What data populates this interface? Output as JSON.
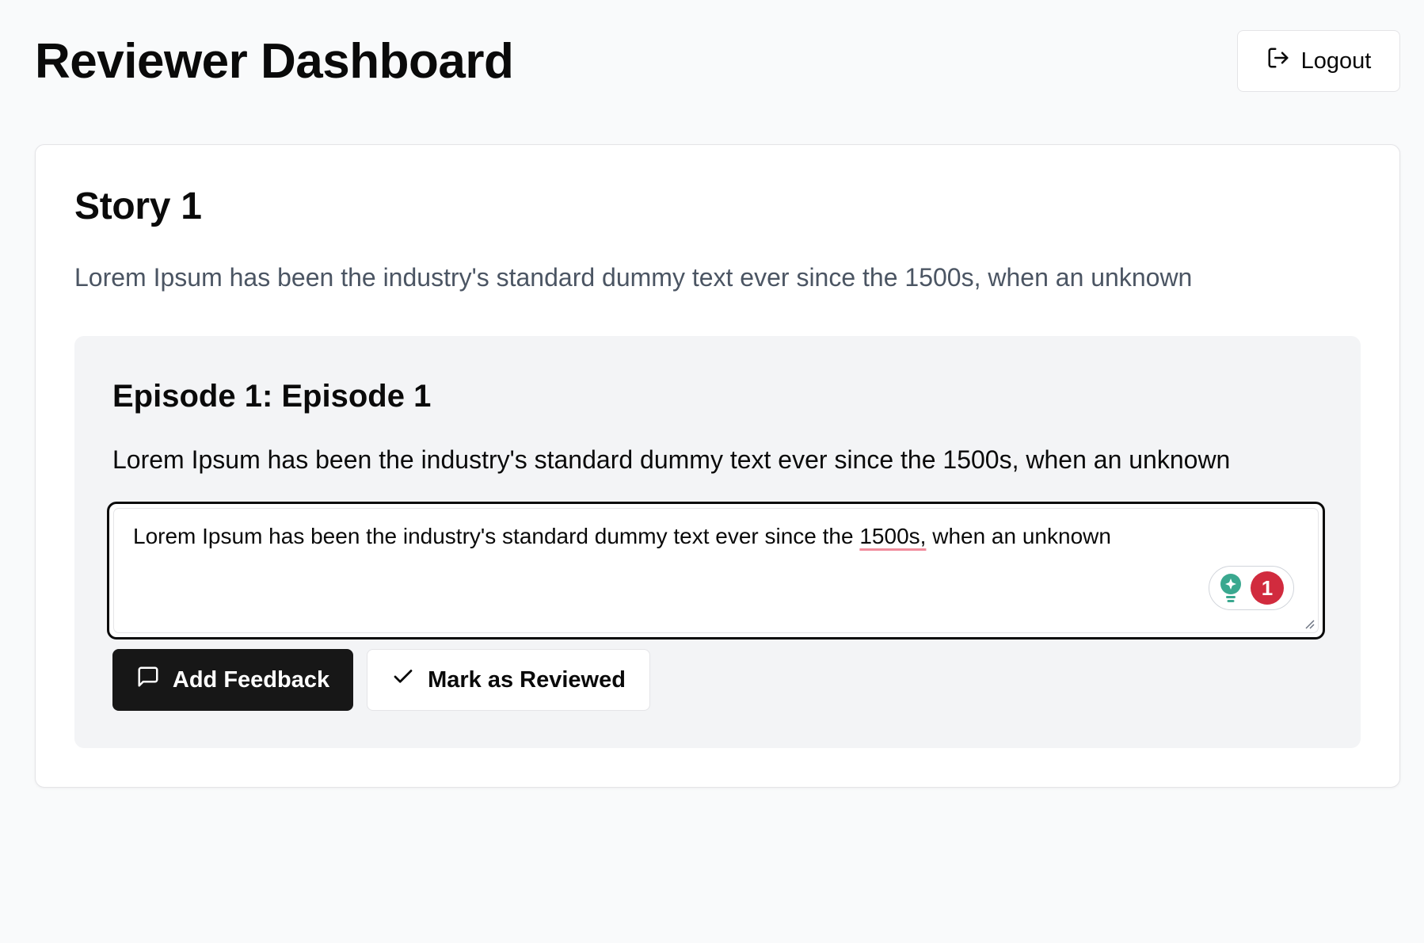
{
  "header": {
    "title": "Reviewer Dashboard",
    "logout_label": "Logout",
    "logout_icon": "logout-icon"
  },
  "story": {
    "title": "Story 1",
    "description": "Lorem Ipsum has been the industry's standard dummy text ever since the 1500s, when an unknown"
  },
  "episode": {
    "title": "Episode 1: Episode 1",
    "description": "Lorem Ipsum has been the industry's standard dummy text ever since the 1500s, when an unknown",
    "feedback": {
      "text_before": "Lorem Ipsum has been the industry's standard dummy text ever since the ",
      "flagged_word": "1500s,",
      "text_after": " when an unknown",
      "assistant_icon": "lightbulb-icon",
      "issue_count": "1"
    },
    "actions": {
      "add_feedback_label": "Add Feedback",
      "add_feedback_icon": "message-square-icon",
      "mark_reviewed_label": "Mark as Reviewed",
      "mark_reviewed_icon": "check-icon"
    }
  },
  "colors": {
    "background": "#f9fafb",
    "primary_button": "#171717",
    "issue_badge": "#d12b3e",
    "assistant_green": "#3aa88f",
    "flag_underline": "#f08c9c"
  }
}
